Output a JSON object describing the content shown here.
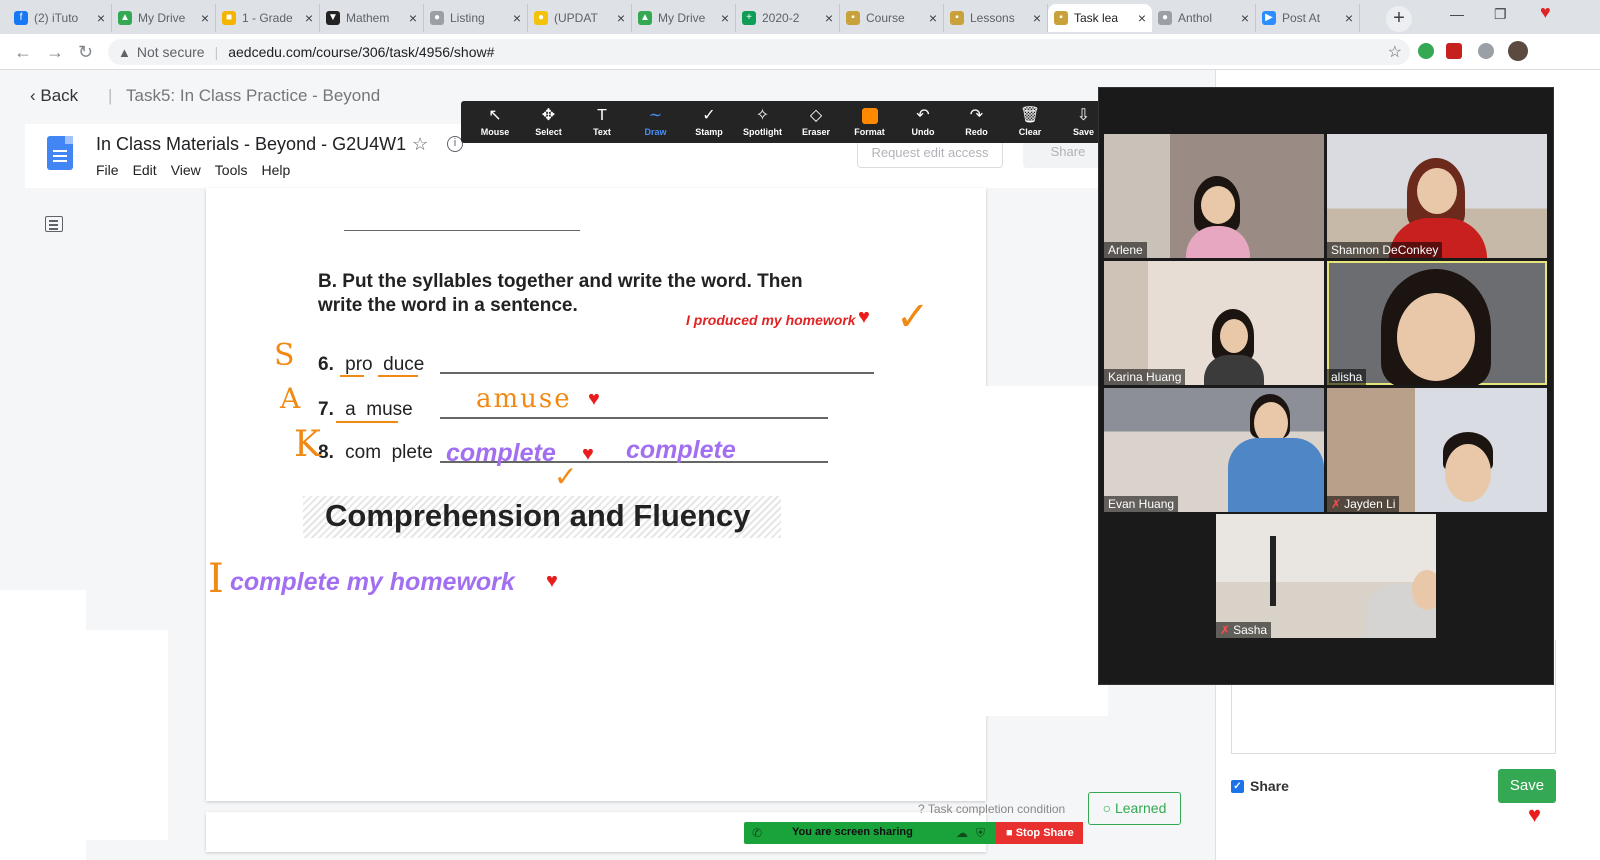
{
  "tabs": [
    {
      "label": "(2) iTuto",
      "color": "#1877f2",
      "glyph": "f"
    },
    {
      "label": "My Drive",
      "color": "#34a853",
      "glyph": "▲"
    },
    {
      "label": "1 - Grade",
      "color": "#f4b400",
      "glyph": "■"
    },
    {
      "label": "Mathem",
      "color": "#222222",
      "glyph": "▼"
    },
    {
      "label": "Listing",
      "color": "#9aa0a6",
      "glyph": "●"
    },
    {
      "label": "(UPDAT",
      "color": "#f4c20d",
      "glyph": "●"
    },
    {
      "label": "My Drive",
      "color": "#34a853",
      "glyph": "▲"
    },
    {
      "label": "2020-2",
      "color": "#0f9d58",
      "glyph": "+"
    },
    {
      "label": "Course",
      "color": "#c9a13a",
      "glyph": "▪"
    },
    {
      "label": "Lessons",
      "color": "#c9a13a",
      "glyph": "▪"
    },
    {
      "label": "Task lea",
      "color": "#c9a13a",
      "glyph": "▪",
      "active": true
    },
    {
      "label": "Anthol",
      "color": "#9aa0a6",
      "glyph": "●"
    },
    {
      "label": "Post At",
      "color": "#2d8cff",
      "glyph": "▶"
    }
  ],
  "address": {
    "security": "Not secure",
    "url": "aedcedu.com/course/306/task/4956/show#"
  },
  "header": {
    "back_label": "Back",
    "breadcrumb": "Task5:  In Class Practice - Beyond"
  },
  "docs": {
    "title": "In Class Materials - Beyond - G2U4W1",
    "menu": [
      "File",
      "Edit",
      "View",
      "Tools",
      "Help"
    ],
    "request_access": "Request edit access",
    "share": "Share"
  },
  "worksheet": {
    "instruction_line1": "B. Put the syllables together and write the word. Then",
    "instruction_line2": "write the word in a sentence.",
    "items": [
      {
        "num": "6.",
        "parts": [
          "pro",
          "duce"
        ]
      },
      {
        "num": "7.",
        "parts": [
          "a",
          "muse"
        ]
      },
      {
        "num": "8.",
        "parts": [
          "com",
          "plete"
        ]
      }
    ],
    "section_title": "Comprehension and Fluency"
  },
  "annotations": {
    "red_sentence": "I produced my homework",
    "amuse": "amuse",
    "complete_1": "complete",
    "complete_2": "complete",
    "sentence": "complete my homework",
    "letter_s": "S",
    "letter_a": "A",
    "letter_k": "K",
    "letter_i": "I"
  },
  "footer": {
    "task_completion": "Task completion condition",
    "learned": "Learned"
  },
  "right_panel": {
    "share_label": "Share",
    "save_label": "Save"
  },
  "zoom_toolbar": [
    {
      "label": "Mouse",
      "icon": "↖"
    },
    {
      "label": "Select",
      "icon": "✥"
    },
    {
      "label": "Text",
      "icon": "T"
    },
    {
      "label": "Draw",
      "icon": "∼",
      "active": true
    },
    {
      "label": "Stamp",
      "icon": "✓"
    },
    {
      "label": "Spotlight",
      "icon": "✧"
    },
    {
      "label": "Eraser",
      "icon": "◇"
    },
    {
      "label": "Format",
      "icon": "fmt"
    },
    {
      "label": "Undo",
      "icon": "↶"
    },
    {
      "label": "Redo",
      "icon": "↷"
    },
    {
      "label": "Clear",
      "icon": "🗑"
    },
    {
      "label": "Save",
      "icon": "⇩"
    }
  ],
  "participants": [
    {
      "name": "Arlene",
      "muted": false
    },
    {
      "name": "Shannon DeConkey",
      "muted": false
    },
    {
      "name": "Karina Huang",
      "muted": false
    },
    {
      "name": "alisha",
      "muted": false,
      "speaking": true
    },
    {
      "name": "Evan Huang",
      "muted": false
    },
    {
      "name": "Jayden Li",
      "muted": true
    },
    {
      "name": "Sasha",
      "muted": true
    }
  ],
  "screen_share": {
    "status": "You are screen sharing",
    "stop": "Stop Share"
  }
}
